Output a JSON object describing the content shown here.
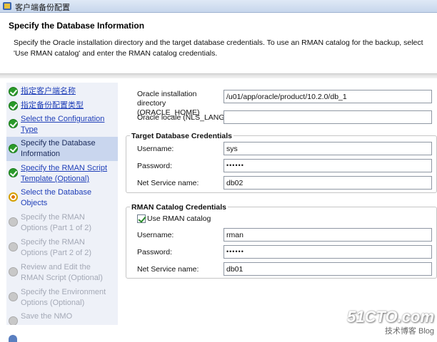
{
  "window": {
    "title": "客户端备份配置"
  },
  "header": {
    "title": "Specify the Database Information",
    "description": "Specify the Oracle installation directory and the target database credentials. To use an RMAN catalog for the backup, select 'Use RMAN catalog' and enter the RMAN catalog credentials."
  },
  "nav": {
    "items": [
      {
        "label": "指定客户端名称",
        "state": "done"
      },
      {
        "label": "指定备份配置类型",
        "state": "done"
      },
      {
        "label": "Select the Configuration Type",
        "state": "done"
      },
      {
        "label": "Specify the Database Information",
        "state": "current"
      },
      {
        "label": "Specify the RMAN Script Template (Optional)",
        "state": "done"
      },
      {
        "label": "Select the Database Objects",
        "state": "next"
      },
      {
        "label": "Specify the RMAN Options (Part 1 of 2)",
        "state": "todo"
      },
      {
        "label": "Specify the RMAN Options (Part 2 of 2)",
        "state": "todo"
      },
      {
        "label": "Review and Edit the RMAN Script (Optional)",
        "state": "todo"
      },
      {
        "label": "Specify the Environment Options (Optional)",
        "state": "todo"
      },
      {
        "label": "Save the NMO",
        "state": "todo"
      }
    ]
  },
  "form": {
    "oracle_home_label": "Oracle installation directory (ORACLE_HOME)",
    "oracle_home_value": "/u01/app/oracle/product/10.2.0/db_1",
    "locale_label": "Oracle locale (NLS_LANG):",
    "locale_value": "",
    "target": {
      "title": "Target Database Credentials",
      "username_label": "Username:",
      "username_value": "sys",
      "password_label": "Password:",
      "password_value": "••••••",
      "service_label": "Net Service name:",
      "service_value": "db02"
    },
    "catalog": {
      "title": "RMAN Catalog Credentials",
      "use_catalog_label": "Use RMAN catalog",
      "use_catalog_checked": true,
      "username_label": "Username:",
      "username_value": "rman",
      "password_label": "Password:",
      "password_value": "••••••",
      "service_label": "Net Service name:",
      "service_value": "db01"
    }
  },
  "watermark": {
    "line1": "51CTO.com",
    "line2": "技术博客 Blog"
  }
}
